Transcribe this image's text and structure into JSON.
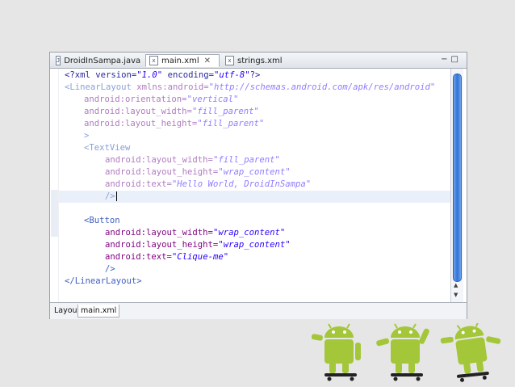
{
  "tabs": [
    {
      "label": "DroidInSampa.java",
      "icon": "java-file-icon",
      "active": false
    },
    {
      "label": "main.xml",
      "icon": "xml-file-icon",
      "active": true,
      "close": "✕"
    },
    {
      "label": "strings.xml",
      "icon": "xml-file-icon",
      "active": false
    }
  ],
  "window_controls": {
    "minimize": "−",
    "maximize": "□"
  },
  "code": {
    "l1": {
      "a": "<?xml version=",
      "b": "\"1.0\"",
      "c": " encoding=",
      "d": "\"utf-8\"",
      "e": "?>"
    },
    "l2": {
      "a": "<LinearLayout",
      "b": " xmlns:android=",
      "c": "\"http://schemas.android.com/apk/res/android\""
    },
    "l3": {
      "a": "android:orientation=",
      "b": "\"vertical\""
    },
    "l4": {
      "a": "android:layout_width=",
      "b": "\"fill_parent\""
    },
    "l5": {
      "a": "android:layout_height=",
      "b": "\"fill_parent\""
    },
    "l6": {
      "a": ">"
    },
    "l7": {
      "a": "<TextView"
    },
    "l8": {
      "a": "android:layout_width=",
      "b": "\"fill_parent\""
    },
    "l9": {
      "a": "android:layout_height=",
      "b": "\"wrap_content\""
    },
    "l10": {
      "a": "android:text=",
      "b": "\"Hello World, DroidInSampa\""
    },
    "l11": {
      "a": "/>"
    },
    "l12": {
      "a": ""
    },
    "l13": {
      "a": "<Button"
    },
    "l14": {
      "a": "android:layout_width=",
      "b": "\"wrap_content\""
    },
    "l15": {
      "a": "android:layout_height=",
      "b": "\"wrap_content\""
    },
    "l16": {
      "a": "android:text=",
      "b": "\"Clique-me\""
    },
    "l17": {
      "a": "/>"
    },
    "l18": {
      "a": "</LinearLayout>"
    }
  },
  "bottom_tabs": [
    {
      "label": "Layout",
      "active": false
    },
    {
      "label": "main.xml",
      "active": true
    }
  ],
  "colors": {
    "android_green": "#a4c639",
    "scroll_thumb": "#2f74d8",
    "tag": "#3f5fbf",
    "attribute": "#7f007f",
    "value": "#2a00ff"
  },
  "decor": {
    "icon": "skateboarding-android-robots"
  }
}
